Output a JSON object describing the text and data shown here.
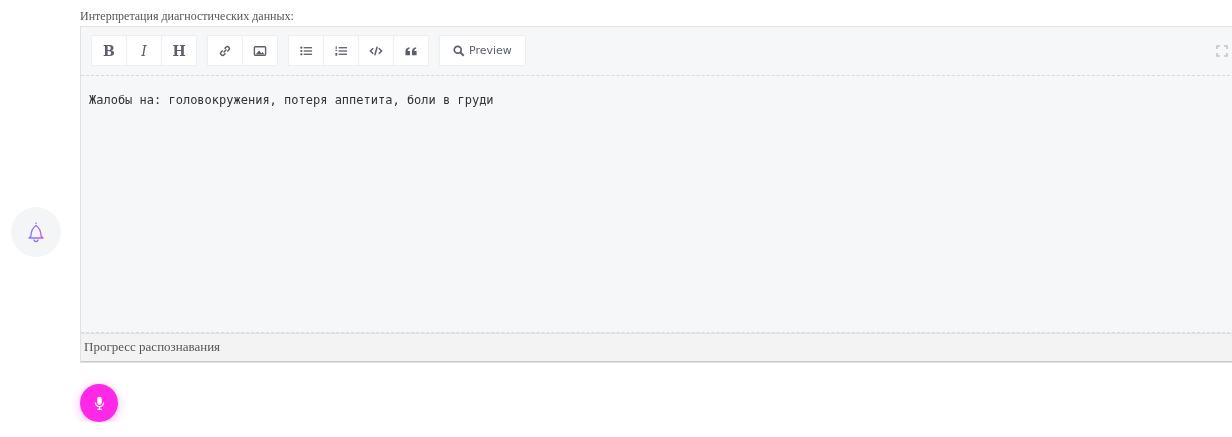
{
  "field_label": "Интерпретация диагностических данных:",
  "toolbar": {
    "groups": [
      [
        {
          "kind": "bold",
          "label": "B"
        },
        {
          "kind": "italic",
          "label": "I"
        },
        {
          "kind": "heading",
          "label": "H"
        }
      ],
      [
        {
          "kind": "link"
        },
        {
          "kind": "image"
        }
      ],
      [
        {
          "kind": "bullet-list"
        },
        {
          "kind": "numbered-list"
        },
        {
          "kind": "code"
        },
        {
          "kind": "quote"
        }
      ],
      [
        {
          "kind": "preview",
          "label": "Preview"
        }
      ]
    ]
  },
  "editor": {
    "value": "Жалобы на: головокружения, потеря аппетита, боли в груди"
  },
  "progress": {
    "label": "Прогресс распознавания"
  }
}
